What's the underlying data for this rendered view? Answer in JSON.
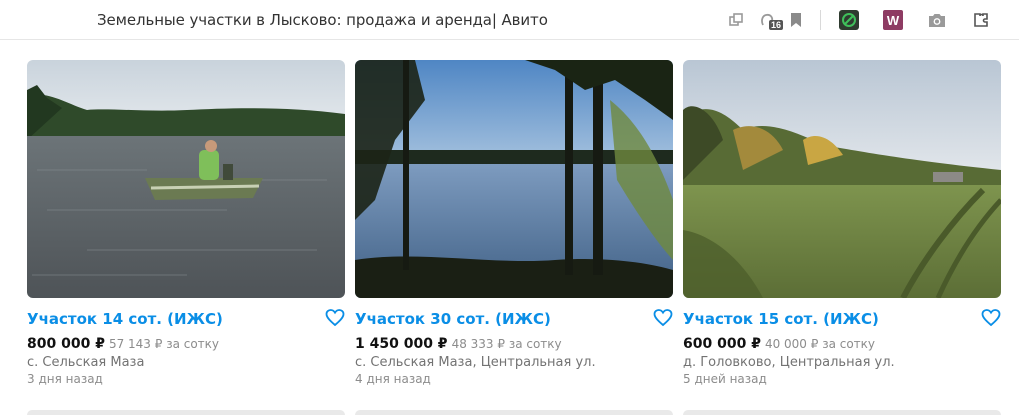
{
  "header": {
    "title": "Земельные участки в Лысково: продажа и аренда| Авито",
    "tab_count": "16",
    "icons": [
      "copy-icon",
      "tabs-count-icon",
      "bookmark-icon",
      "green-extension-icon",
      "w-extension-icon",
      "camera-icon",
      "puzzle-extension-icon"
    ]
  },
  "listings": [
    {
      "title": "Участок 14 сот. (ИЖС)",
      "price": "800 000 ₽",
      "per_sotka": "57 143 ₽ за сотку",
      "address": "с. Сельская Маза",
      "date": "3 дня назад",
      "photo": "lake-with-boat"
    },
    {
      "title": "Участок 30 сот. (ИЖС)",
      "price": "1 450 000 ₽",
      "per_sotka": "48 333 ₽ за сотку",
      "address": "с. Сельская Маза, Центральная ул.",
      "date": "4 дня назад",
      "photo": "lake-through-trees"
    },
    {
      "title": "Участок 15 сот. (ИЖС)",
      "price": "600 000 ₽",
      "per_sotka": "40 000 ₽ за сотку",
      "address": "д. Головково, Центральная ул.",
      "date": "5 дней назад",
      "photo": "green-field"
    }
  ],
  "colors": {
    "link": "#0a8ee6",
    "muted": "#8c8c8c"
  }
}
